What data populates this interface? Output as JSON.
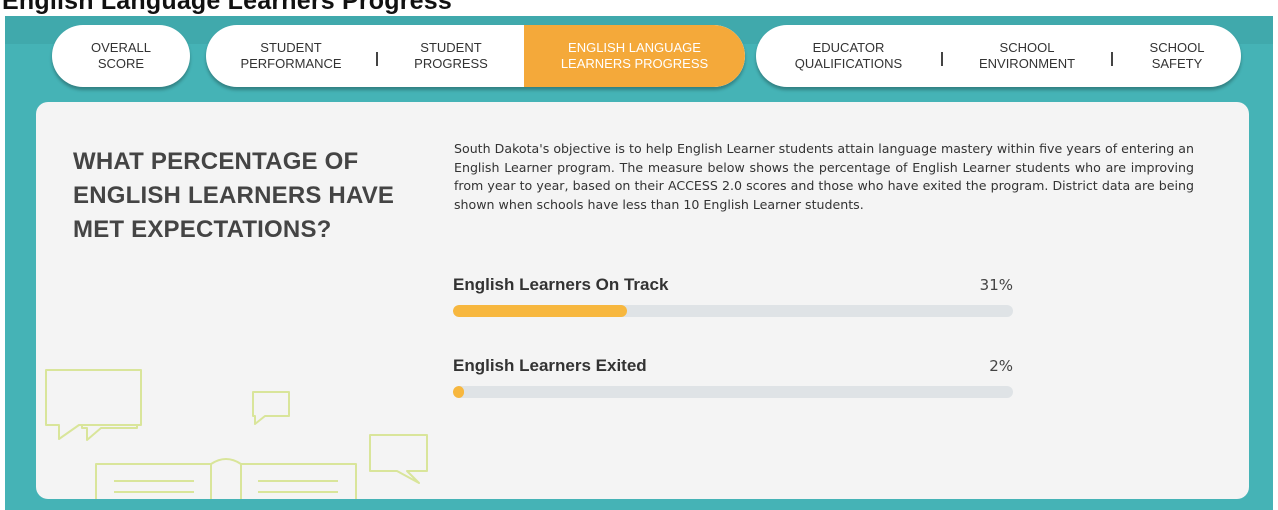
{
  "page": {
    "cut_title": "English Language Learners Progress",
    "heading": "WHAT PERCENTAGE OF ENGLISH LEARNERS HAVE MET EXPECTATIONS?",
    "description": "South Dakota's objective is to help English Learner students attain language mastery within five years of entering an English Learner program. The measure below shows the percentage of English Learner students who are improving from year to year, based on their ACCESS 2.0 scores and those who have exited the program. District data are being shown when schools have less than 10 English Learner students."
  },
  "tabs": {
    "overall": "OVERALL\nSCORE",
    "student_performance": "STUDENT\nPERFORMANCE",
    "student_progress": "STUDENT\nPROGRESS",
    "ell_progress": "ENGLISH LANGUAGE\nLEARNERS PROGRESS",
    "educator_qualifications": "EDUCATOR\nQUALIFICATIONS",
    "school_environment": "SCHOOL\nENVIRONMENT",
    "school_safety": "SCHOOL\nSAFETY",
    "active": "ell_progress"
  },
  "metrics": [
    {
      "label": "English Learners On Track",
      "value_text": "31%",
      "value": 31
    },
    {
      "label": "English Learners Exited",
      "value_text": "2%",
      "value": 2
    }
  ],
  "colors": {
    "teal_background": "#45b3b6",
    "active_tab": "#f4a93a",
    "bar_fill": "#f7b73e",
    "bar_track": "#dfe3e6",
    "card": "#f4f4f4",
    "illustration_stroke": "#d9e59a"
  },
  "icons": {
    "illustration": "open-book-with-speech-bubbles"
  }
}
